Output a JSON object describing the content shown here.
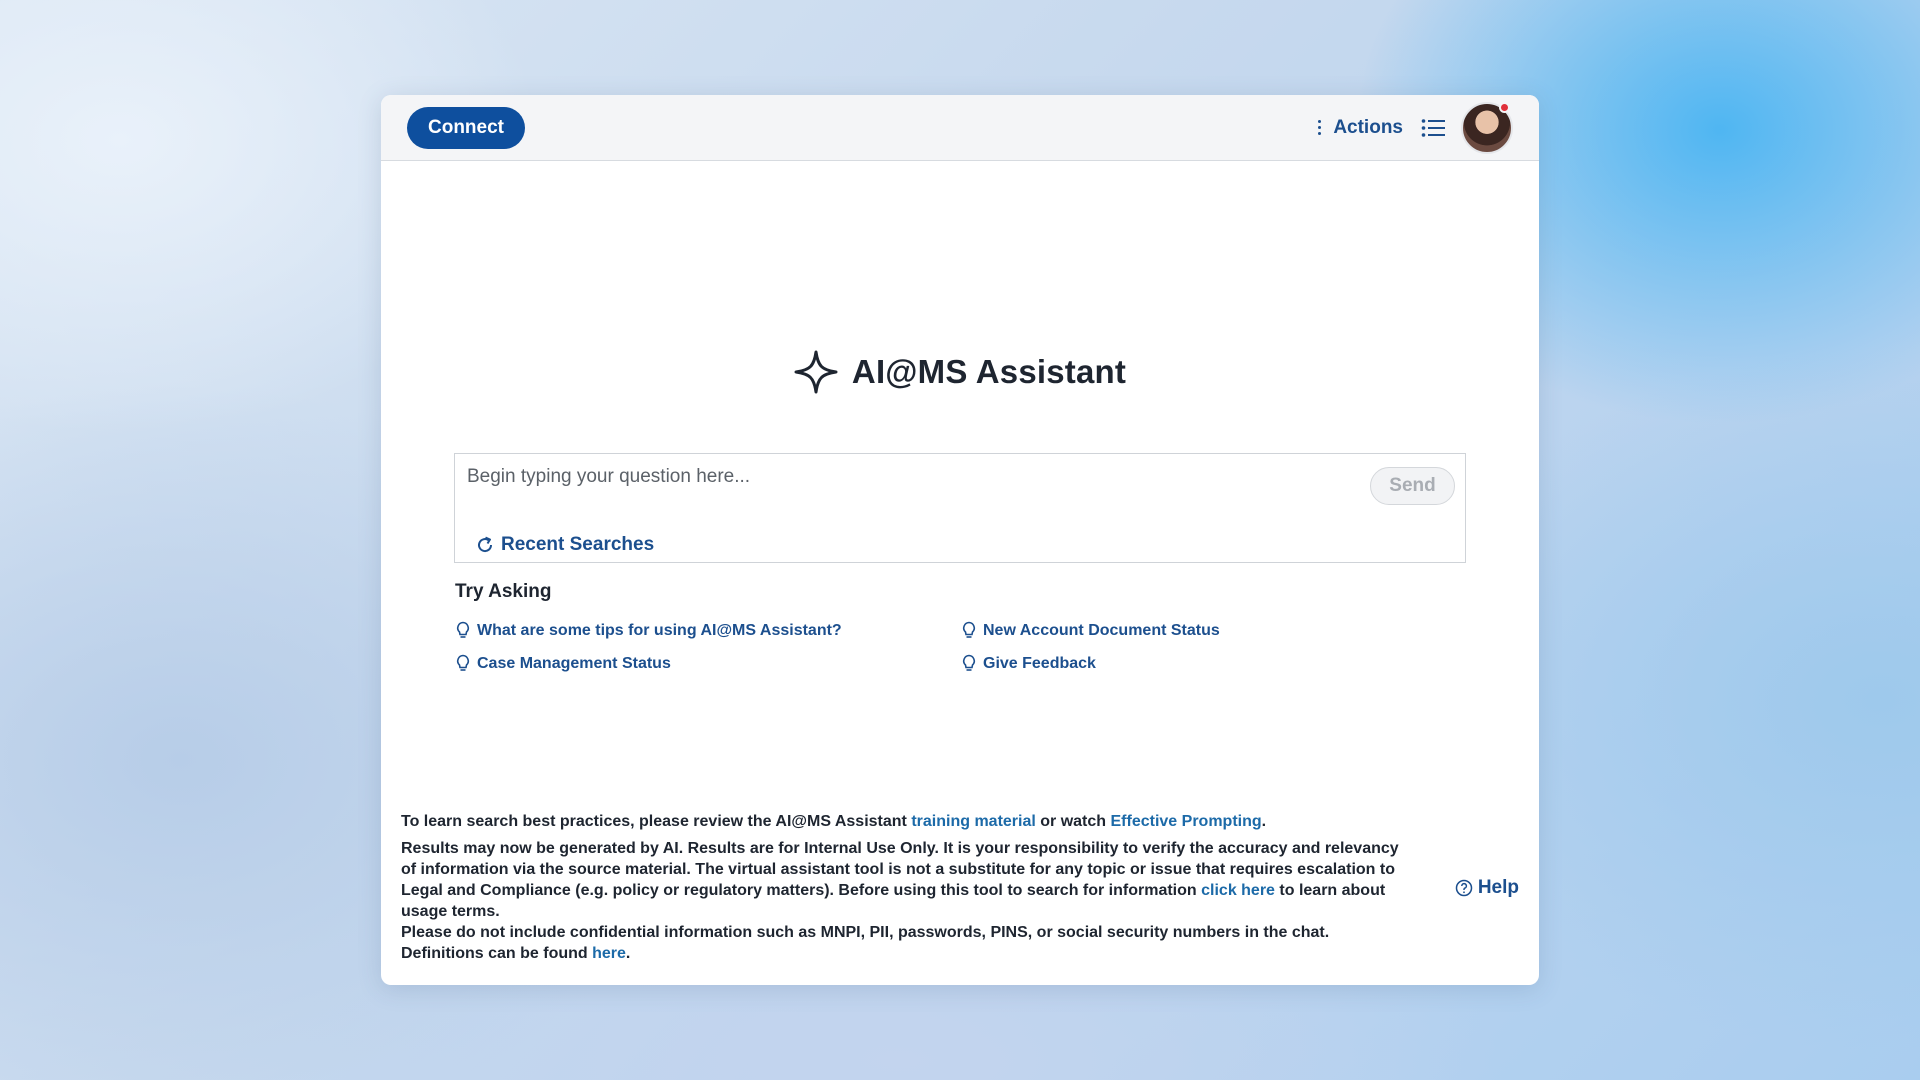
{
  "header": {
    "connect_label": "Connect",
    "actions_label": "Actions"
  },
  "hero": {
    "title": "AI@MS Assistant"
  },
  "query": {
    "placeholder": "Begin typing your question here...",
    "value": "",
    "send_label": "Send",
    "recent_label": "Recent Searches"
  },
  "try_asking": {
    "title": "Try Asking",
    "items": [
      {
        "label": "What are some tips for using AI@MS Assistant?"
      },
      {
        "label": "New Account Document Status"
      },
      {
        "label": "Case Management Status"
      },
      {
        "label": "Give Feedback"
      }
    ]
  },
  "footer": {
    "line1_prefix": "To learn search best practices, please review the AI@MS Assistant ",
    "training_link": "training material",
    "line1_middle": " or watch ",
    "prompting_link": "Effective Prompting",
    "line1_suffix": ".",
    "disclaimer": "Results may now be generated by AI. Results are for Internal Use Only. It is your responsibility to verify the accuracy and relevancy of information via the source material. The virtual assistant tool is not a substitute for any topic or issue that requires escalation to Legal and Compliance (e.g. policy or regulatory matters). Before using this tool to search for information ",
    "click_here_link": "click here",
    "usage_suffix": " to learn about usage terms.",
    "confidential": "Please do not include confidential information such as MNPI, PII, passwords, PINS, or social security numbers in the chat.",
    "definitions_prefix": "Definitions can be found ",
    "here_link": "here",
    "definitions_suffix": "."
  },
  "help": {
    "label": "Help"
  },
  "colors": {
    "brand_blue": "#0e4f9e",
    "link_blue": "#1c6aa8",
    "notification_red": "#e0303a"
  }
}
